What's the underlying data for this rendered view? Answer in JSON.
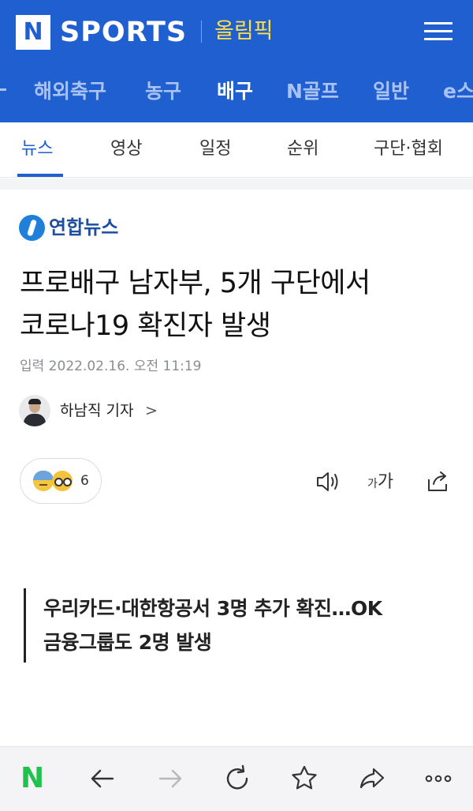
{
  "header": {
    "logo_letter": "N",
    "brand": "SPORTS",
    "section_link": "올림픽",
    "colors": {
      "background": "#1f5fd0",
      "section_link": "#ffe04a",
      "inactive_category": "#a9c2f2"
    }
  },
  "categories": [
    {
      "label": "해외축구",
      "active": false
    },
    {
      "label": "농구",
      "active": false
    },
    {
      "label": "배구",
      "active": true
    },
    {
      "label": "N골프",
      "active": false
    },
    {
      "label": "일반",
      "active": false
    },
    {
      "label": "e스",
      "active": false
    }
  ],
  "subtabs": [
    {
      "label": "뉴스",
      "active": true
    },
    {
      "label": "영상",
      "active": false
    },
    {
      "label": "일정",
      "active": false
    },
    {
      "label": "순위",
      "active": false
    },
    {
      "label": "구단·협회",
      "active": false
    }
  ],
  "article": {
    "press": "연합뉴스",
    "headline_lines": [
      "프로배구 남자부, 5개 구단에서",
      "코로나19 확진자 발생"
    ],
    "timestamp": "입력 2022.02.16. 오전 11:19",
    "author": "하남직 기자",
    "author_chevron": ">",
    "reaction_count": "6",
    "font_size_small": "가",
    "font_size_big": "가",
    "quote_lines": [
      "우리카드·대한항공서 3명 추가 확진…OK",
      "금융그룹도 2명 발생"
    ]
  },
  "bottom_bar": {
    "logo_letter": "N",
    "logo_color": "#21c14d",
    "icons": [
      "back-arrow-icon",
      "forward-arrow-icon",
      "refresh-icon",
      "star-icon",
      "share-icon",
      "more-icon"
    ]
  }
}
